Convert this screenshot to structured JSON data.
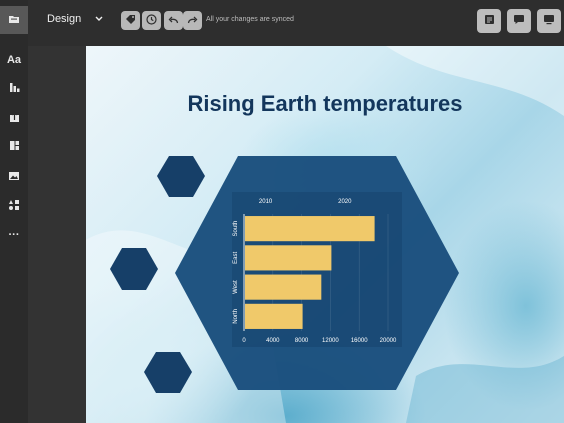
{
  "toolbar": {
    "design_label": "Design",
    "sync_status": "All your changes are synced",
    "colors": {
      "bar": "#2e2e2e",
      "button": "#b8b8b8"
    }
  },
  "sidebar": {
    "items": [
      {
        "icon": "folder-icon",
        "label": ""
      },
      {
        "icon": "text-icon",
        "label": "Aa"
      },
      {
        "icon": "chart-icon",
        "label": ""
      },
      {
        "icon": "upload-icon",
        "label": ""
      },
      {
        "icon": "template-icon",
        "label": ""
      },
      {
        "icon": "image-icon",
        "label": ""
      },
      {
        "icon": "elements-icon",
        "label": ""
      },
      {
        "icon": "more-icon",
        "label": "···"
      }
    ]
  },
  "slide": {
    "title": "Rising Earth temperatures",
    "colors": {
      "hex": "#1a4e7d",
      "hex_dark": "#163f68",
      "title": "#13365c"
    }
  },
  "chart_data": {
    "type": "bar",
    "orientation": "horizontal",
    "categories": [
      "South",
      "East",
      "West",
      "North"
    ],
    "values": [
      18000,
      12000,
      10600,
      8000
    ],
    "x_ticks": [
      "0",
      "4000",
      "8000",
      "12000",
      "16000",
      "20000"
    ],
    "xlim": [
      0,
      20000
    ],
    "top_labels": [
      "2010",
      "2020"
    ],
    "bar_color": "#f0c96a"
  }
}
